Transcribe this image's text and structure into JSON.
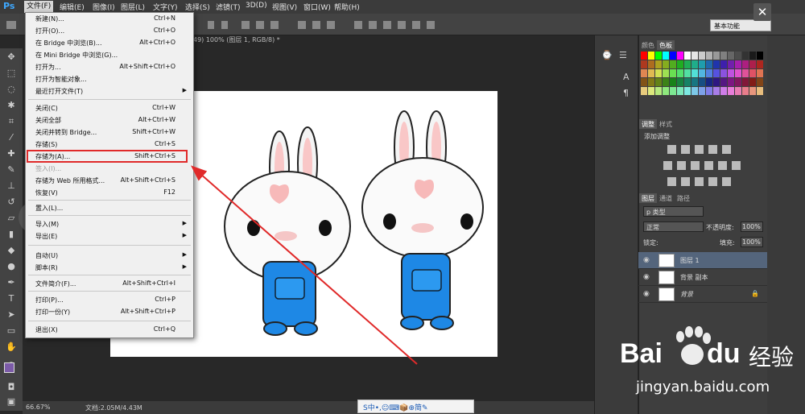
{
  "menubar": {
    "logo": "Ps",
    "items": [
      "文件(F)",
      "编辑(E)",
      "图像(I)",
      "图层(L)",
      "文字(Y)",
      "选择(S)",
      "滤镜(T)",
      "3D(D)",
      "视图(V)",
      "窗口(W)",
      "帮助(H)"
    ]
  },
  "options": {
    "workspace": "基本功能",
    "close": "✕"
  },
  "doc_tab": "49) 100% (图层 1, RGB/8) *",
  "status": {
    "zoom": "66.67%",
    "doc": "文档:2.05M/4.43M"
  },
  "file_menu": [
    {
      "label": "新建(N)...",
      "shortcut": "Ctrl+N"
    },
    {
      "label": "打开(O)...",
      "shortcut": "Ctrl+O"
    },
    {
      "label": "在 Bridge 中浏览(B)...",
      "shortcut": "Alt+Ctrl+O"
    },
    {
      "label": "在 Mini Bridge 中浏览(G)...",
      "shortcut": ""
    },
    {
      "label": "打开为...",
      "shortcut": "Alt+Shift+Ctrl+O"
    },
    {
      "label": "打开为智能对象...",
      "shortcut": ""
    },
    {
      "label": "最近打开文件(T)",
      "shortcut": "",
      "arrow": "▶"
    },
    {
      "label": "关闭(C)",
      "shortcut": "Ctrl+W"
    },
    {
      "label": "关闭全部",
      "shortcut": "Alt+Ctrl+W"
    },
    {
      "label": "关闭并转到 Bridge...",
      "shortcut": "Shift+Ctrl+W"
    },
    {
      "label": "存储(S)",
      "shortcut": "Ctrl+S"
    },
    {
      "label": "存储为(A)...",
      "shortcut": "Shift+Ctrl+S"
    },
    {
      "label": "签入(I)...",
      "shortcut": "",
      "disabled": true
    },
    {
      "label": "存储为 Web 所用格式...",
      "shortcut": "Alt+Shift+Ctrl+S"
    },
    {
      "label": "恢复(V)",
      "shortcut": "F12"
    },
    {
      "label": "置入(L)...",
      "shortcut": ""
    },
    {
      "label": "导入(M)",
      "shortcut": "",
      "arrow": "▶"
    },
    {
      "label": "导出(E)",
      "shortcut": "",
      "arrow": "▶"
    },
    {
      "label": "自动(U)",
      "shortcut": "",
      "arrow": "▶"
    },
    {
      "label": "脚本(R)",
      "shortcut": "",
      "arrow": "▶"
    },
    {
      "label": "文件简介(F)...",
      "shortcut": "Alt+Shift+Ctrl+I"
    },
    {
      "label": "打印(P)...",
      "shortcut": "Ctrl+P"
    },
    {
      "label": "打印一份(Y)",
      "shortcut": "Alt+Shift+Ctrl+P"
    },
    {
      "label": "退出(X)",
      "shortcut": "Ctrl+Q"
    }
  ],
  "panels": {
    "swatch_tabs": [
      "颜色",
      "色板"
    ],
    "adjust_tabs": [
      "调整",
      "样式"
    ],
    "adjust_title": "添加调整",
    "layer_tabs": [
      "图层",
      "通道",
      "路径"
    ],
    "kind": "p 类型",
    "blend": "正常",
    "opacity_label": "不透明度:",
    "opacity": "100%",
    "lock_label": "锁定:",
    "fill_label": "填充:",
    "fill": "100%",
    "layers": [
      {
        "name": "图层 1"
      },
      {
        "name": "背景 副本"
      },
      {
        "name": "背景"
      }
    ]
  },
  "watermark": {
    "brand": "Bai",
    "brand2": "du",
    "tail": "经验",
    "url": "jingyan.baidu.com"
  },
  "ime": "S中•,☺⌨📦⊕简✎",
  "nav_left": "‹",
  "colors": {
    "highlight": "#e02a2a",
    "arrow": "#e02a2a",
    "selected_layer": "#54657c"
  }
}
